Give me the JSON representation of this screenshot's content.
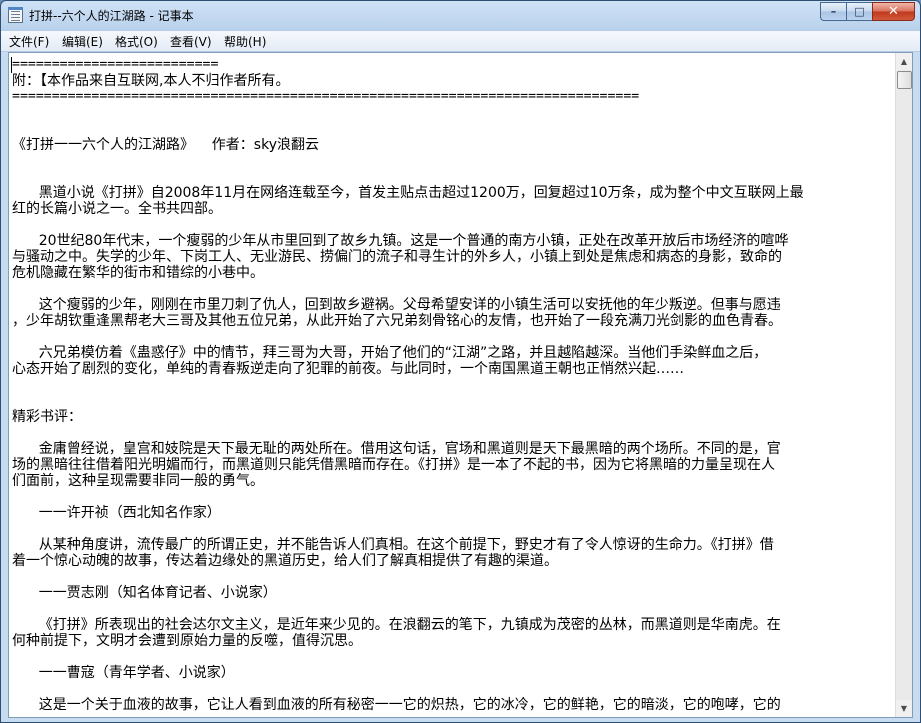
{
  "window": {
    "title": "打拼--六个人的江湖路 - 记事本",
    "buttons": {
      "minimize": "–",
      "maximize": "□",
      "close": "✕"
    }
  },
  "menu": [
    "文件(F)",
    "编辑(E)",
    "格式(O)",
    "查看(V)",
    "帮助(H)"
  ],
  "document": {
    "lines": [
      "==========================",
      "附：【本作品来自互联网,本人不归作者所有。",
      "===============================================================================",
      "",
      "",
      "《打拼一一六个人的江湖路》    作者：sky浪翻云",
      "",
      "",
      "      黑道小说《打拼》自2008年11月在网络连载至今，首发主贴点击超过1200万，回复超过10万条，成为整个中文互联网上最",
      "红的长篇小说之一。全书共四部。",
      "",
      "      20世纪80年代末，一个瘦弱的少年从市里回到了故乡九镇。这是一个普通的南方小镇，正处在改革开放后市场经济的喧哗",
      "与骚动之中。失学的少年、下岗工人、无业游民、捞偏门的流子和寻生计的外乡人，小镇上到处是焦虑和病态的身影，致命的",
      "危机隐藏在繁华的街市和错综的小巷中。",
      "",
      "      这个瘦弱的少年，刚刚在市里刀刺了仇人，回到故乡避祸。父母希望安详的小镇生活可以安抚他的年少叛逆。但事与愿违",
      "，少年胡钦重逢黑帮老大三哥及其他五位兄弟，从此开始了六兄弟刻骨铭心的友情，也开始了一段充满刀光剑影的血色青春。",
      "",
      "      六兄弟模仿着《蛊惑仔》中的情节，拜三哥为大哥，开始了他们的“江湖”之路，并且越陷越深。当他们手染鲜血之后，",
      "心态开始了剧烈的变化，单纯的青春叛逆走向了犯罪的前夜。与此同时，一个南国黑道王朝也正悄然兴起……",
      "",
      "",
      "精彩书评：",
      "",
      "      金庸曾经说，皇宫和妓院是天下最无耻的两处所在。借用这句话，官场和黑道则是天下最黑暗的两个场所。不同的是，官",
      "场的黑暗往往借着阳光明媚而行，而黑道则只能凭借黑暗而存在。《打拼》是一本了不起的书，因为它将黑暗的力量呈现在人",
      "们面前，这种呈现需要非同一般的勇气。",
      "",
      "      一一许开祯（西北知名作家）",
      "",
      "      从某种角度讲，流传最广的所谓正史，并不能告诉人们真相。在这个前提下，野史才有了令人惊讶的生命力。《打拼》借",
      "着一个惊心动魄的故事，传达着边缘处的黑道历史，给人们了解真相提供了有趣的渠道。",
      "",
      "      一一贾志刚（知名体育记者、小说家）",
      "",
      "      《打拼》所表现出的社会达尔文主义，是近年来少见的。在浪翻云的笔下，九镇成为茂密的丛林，而黑道则是华南虎。在",
      "何种前提下，文明才会遭到原始力量的反噬，值得沉思。",
      "",
      "      一一曹寇（青年学者、小说家）",
      "",
      "      这是一个关于血液的故事，它让人看到血液的所有秘密一一它的炽热，它的冰冷，它的鲜艳，它的暗淡，它的咆哮，它的"
    ]
  },
  "scrollbar": {
    "up_arrow": "▲",
    "down_arrow": "▼",
    "position": 0.0
  }
}
